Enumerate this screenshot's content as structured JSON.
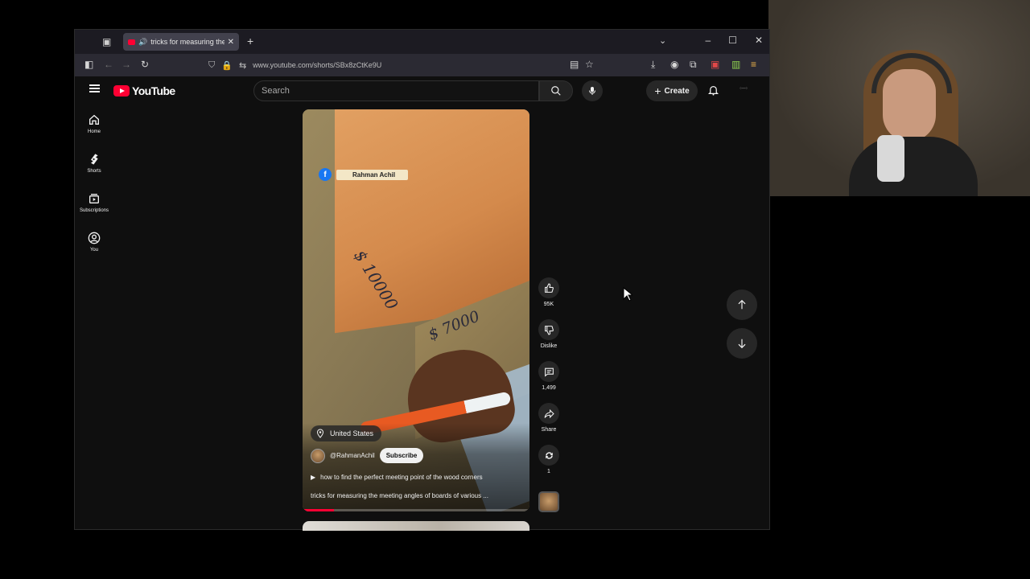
{
  "browser": {
    "tab_title": "tricks for measuring the me",
    "url": "www.youtube.com/shorts/SBx8zCtKe9U"
  },
  "youtube": {
    "logo_text": "YouTube",
    "search_placeholder": "Search",
    "create_label": "Create",
    "sidebar": {
      "items": [
        {
          "label": "Home",
          "icon": "home-icon"
        },
        {
          "label": "Shorts",
          "icon": "shorts-icon"
        },
        {
          "label": "Subscriptions",
          "icon": "subscriptions-icon"
        },
        {
          "label": "You",
          "icon": "you-icon"
        }
      ]
    },
    "short": {
      "watermark_name": "Rahman Achil",
      "scribble_1": "$ 10000",
      "scribble_2": "$ 7000",
      "location": "United States",
      "channel": "@RahmanAchil",
      "subscribe_label": "Subscribe",
      "sound_title": "how to find the perfect meeting point of the wood corners",
      "caption": "tricks for measuring the meeting angles of boards of various ...",
      "progress": 0.14
    },
    "actions": {
      "like_count": "95K",
      "dislike_label": "Dislike",
      "comment_count": "1,499",
      "share_label": "Share",
      "remix_count": "1"
    }
  },
  "colors": {
    "accent": "#ff0033",
    "page_bg": "#0f0f0f",
    "button_bg": "#272727"
  }
}
